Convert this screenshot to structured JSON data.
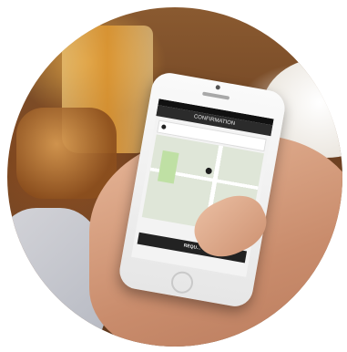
{
  "screen": {
    "status_text": "",
    "title": "CONFIRMATION",
    "back_label": "",
    "pickup_text": "",
    "map_marker_label": "",
    "fare_text": "",
    "request_button": "REQU..."
  }
}
